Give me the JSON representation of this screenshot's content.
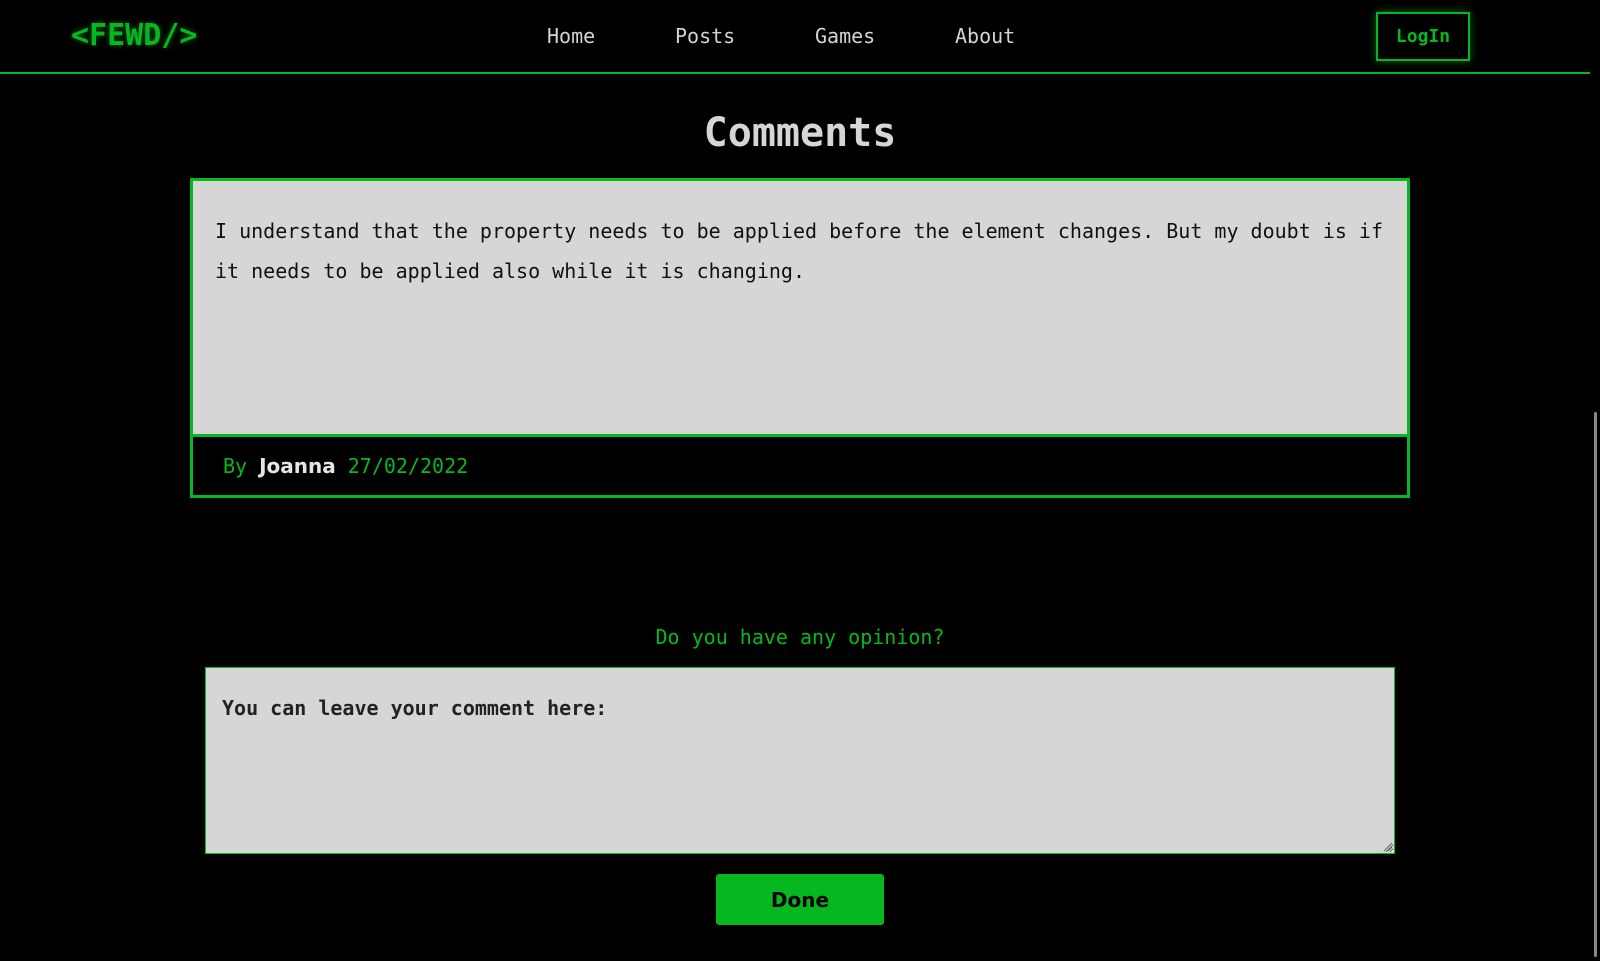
{
  "header": {
    "logo": "<FEWD/>",
    "nav": [
      "Home",
      "Posts",
      "Games",
      "About"
    ],
    "login_label": "LogIn"
  },
  "comments_section": {
    "title": "Comments",
    "comments": [
      {
        "text": "I understand that the property needs to be applied before the element changes. But my doubt is if it needs to be applied also while it is changing.",
        "by_label": "By",
        "author": "Joanna",
        "date": "27/02/2022"
      }
    ]
  },
  "form": {
    "prompt": "Do you have any opinion?",
    "placeholder": "You can leave your comment here:",
    "submit_label": "Done"
  },
  "colors": {
    "accent": "#06b81f",
    "background": "#000000",
    "card": "#d6d6d6"
  }
}
